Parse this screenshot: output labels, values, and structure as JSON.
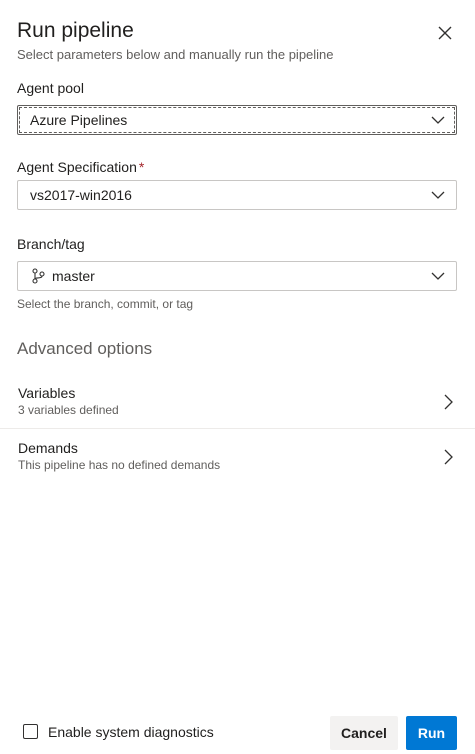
{
  "dialog": {
    "title": "Run pipeline",
    "subtitle": "Select parameters below and manually run the pipeline"
  },
  "agent_pool": {
    "label": "Agent pool",
    "value": "Azure Pipelines"
  },
  "agent_spec": {
    "label": "Agent Specification",
    "required_marker": "*",
    "value": "vs2017-win2016"
  },
  "branch": {
    "label": "Branch/tag",
    "value": "master",
    "helper": "Select the branch, commit, or tag"
  },
  "advanced": {
    "title": "Advanced options",
    "options": [
      {
        "title": "Variables",
        "description": "3 variables defined"
      },
      {
        "title": "Demands",
        "description": "This pipeline has no defined demands"
      }
    ]
  },
  "footer": {
    "diagnostics_label": "Enable system diagnostics",
    "diagnostics_checked": false,
    "cancel_label": "Cancel",
    "run_label": "Run"
  },
  "colors": {
    "primary": "#0078d4",
    "required": "#a4262c",
    "secondary_text": "#605e5c"
  },
  "icons": {
    "close": "close-icon",
    "chevron_down": "chevron-down-icon",
    "chevron_right": "chevron-right-icon",
    "branch": "git-branch-icon"
  }
}
